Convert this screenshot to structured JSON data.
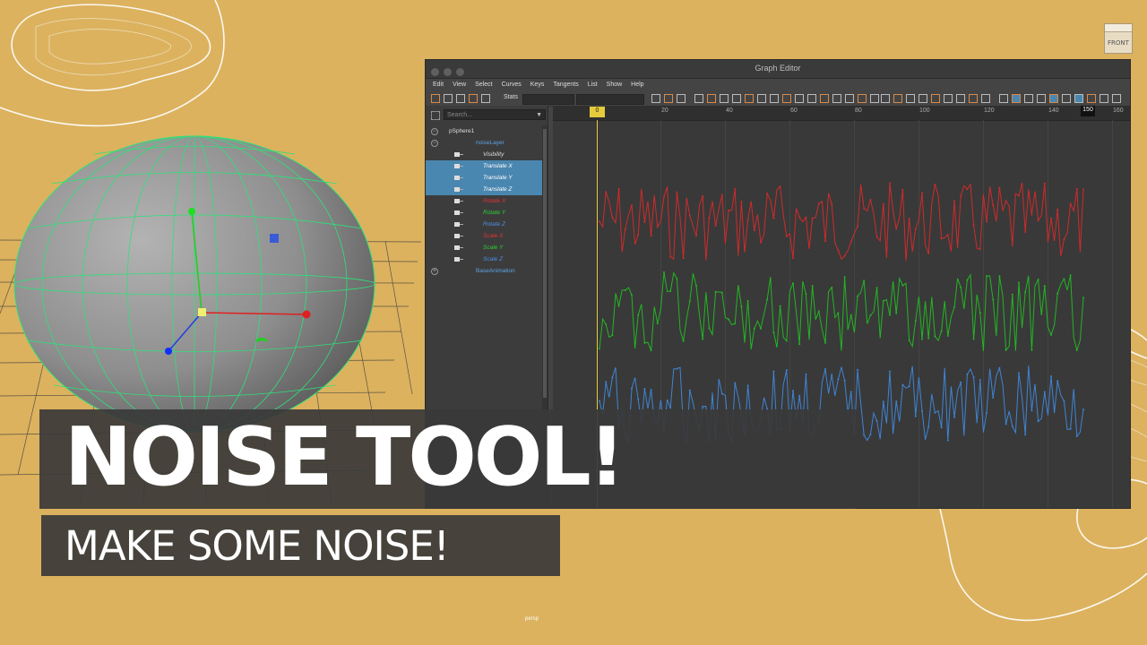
{
  "viewport": {
    "view_cube_label": "FRONT",
    "camera_label": "persp"
  },
  "graph_editor": {
    "title": "Graph Editor",
    "menu": [
      "Edit",
      "View",
      "Select",
      "Curves",
      "Keys",
      "Tangents",
      "List",
      "Show",
      "Help"
    ],
    "stats_label": "Stats",
    "search_placeholder": "Search...",
    "outliner": [
      {
        "label": "pSphere1",
        "indent": 0,
        "color": "#dddddd",
        "selected": false
      },
      {
        "label": "noiseLayer",
        "indent": 1,
        "color": "#5fa3e6",
        "selected": false
      },
      {
        "label": "Visibility",
        "indent": 2,
        "color": "#dddddd",
        "selected": false
      },
      {
        "label": "Translate X",
        "indent": 2,
        "color": "#ffffff",
        "selected": true
      },
      {
        "label": "Translate Y",
        "indent": 2,
        "color": "#ffffff",
        "selected": true
      },
      {
        "label": "Translate Z",
        "indent": 2,
        "color": "#ffffff",
        "selected": true
      },
      {
        "label": "Rotate X",
        "indent": 2,
        "color": "#e23232",
        "selected": false
      },
      {
        "label": "Rotate Y",
        "indent": 2,
        "color": "#2fcf2f",
        "selected": false
      },
      {
        "label": "Rotate Z",
        "indent": 2,
        "color": "#4b8fe0",
        "selected": false
      },
      {
        "label": "Scale X",
        "indent": 2,
        "color": "#e23232",
        "selected": false
      },
      {
        "label": "Scale Y",
        "indent": 2,
        "color": "#2fcf2f",
        "selected": false
      },
      {
        "label": "Scale Z",
        "indent": 2,
        "color": "#4b8fe0",
        "selected": false
      },
      {
        "label": "BaseAnimation",
        "indent": 1,
        "color": "#5fa3e6",
        "selected": false
      }
    ],
    "timeline_ticks": [
      "20",
      "40",
      "60",
      "80",
      "100",
      "120",
      "140",
      "160"
    ],
    "current_frame": "0",
    "end_frame": "150",
    "curve_colors": {
      "x": "#cf2b2b",
      "y": "#23b523",
      "z": "#3f84d4"
    }
  },
  "title": {
    "headline": "NOISE TOOL!",
    "subtitle": "MAKE SOME NOISE!"
  }
}
